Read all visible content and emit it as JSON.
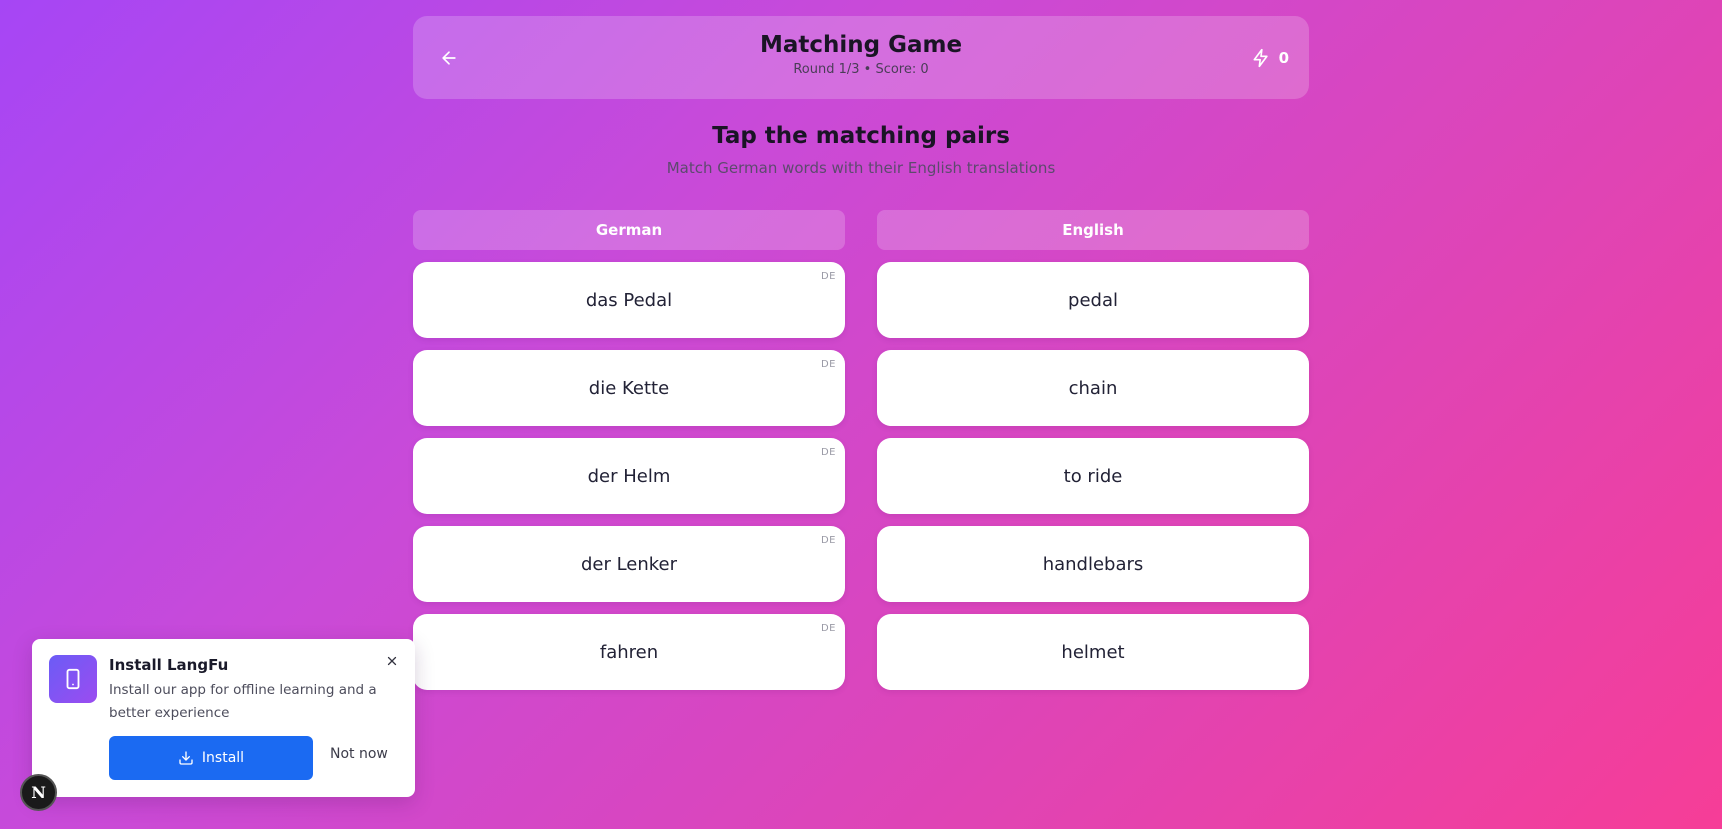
{
  "header": {
    "title": "Matching Game",
    "subtitle": "Round 1/3 • Score: 0",
    "streak_count": "0",
    "back_icon": "arrow-left-icon",
    "streak_icon": "lightning-icon"
  },
  "prompt": {
    "title": "Tap the matching pairs",
    "subtitle": "Match German words with their English translations"
  },
  "columns": {
    "left": {
      "label": "German",
      "items": [
        {
          "text": "das Pedal",
          "tag": "DE"
        },
        {
          "text": "die Kette",
          "tag": "DE"
        },
        {
          "text": "der Helm",
          "tag": "DE"
        },
        {
          "text": "der Lenker",
          "tag": "DE"
        },
        {
          "text": "fahren",
          "tag": "DE"
        }
      ]
    },
    "right": {
      "label": "English",
      "items": [
        {
          "text": "pedal"
        },
        {
          "text": "chain"
        },
        {
          "text": "to ride"
        },
        {
          "text": "handlebars"
        },
        {
          "text": "helmet"
        }
      ]
    }
  },
  "install_popup": {
    "title": "Install LangFu",
    "description": "Install our app for offline learning and a better experience",
    "install_label": "Install",
    "dismiss_label": "Not now",
    "app_icon": "smartphone-icon",
    "close_icon": "close-icon",
    "install_icon": "download-icon"
  },
  "dev_badge": {
    "label": "N"
  },
  "colors": {
    "gradient_start": "#a646f5",
    "gradient_end": "#f63d97",
    "install_button": "#1b6af2",
    "card_background": "#ffffff"
  }
}
